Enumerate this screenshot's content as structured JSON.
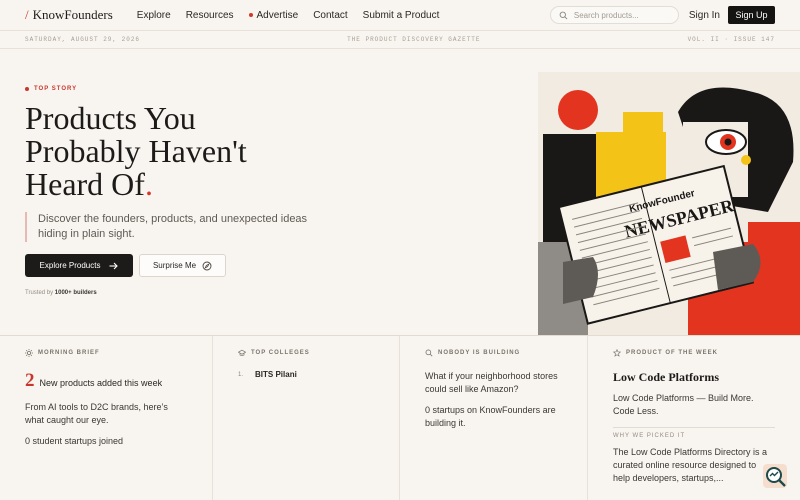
{
  "nav": {
    "brand": "KnowFounders",
    "links": [
      "Explore",
      "Resources",
      "Advertise",
      "Contact",
      "Submit a Product"
    ],
    "search_placeholder": "Search products...",
    "signin": "Sign In",
    "signup": "Sign Up"
  },
  "gazette": {
    "date": "SATURDAY, AUGUST 29, 2026",
    "title": "THE PRODUCT DISCOVERY GAZETTE",
    "issue": "VOL. II · ISSUE 147"
  },
  "hero": {
    "label": "TOP STORY",
    "headline_l1": "Products You",
    "headline_l2": "Probably Haven't",
    "headline_l3": "Heard Of",
    "headline_dot": ".",
    "subtitle": "Discover the founders, products, and unexpected ideas hiding in plain sight.",
    "primary_btn": "Explore Products",
    "secondary_btn": "Surprise Me",
    "trusted_prefix": "Trusted by",
    "trusted_count": "1000+ builders",
    "art_brand": "KnowFounder",
    "art_paper": "NEWSPAPER"
  },
  "cards": {
    "morning": {
      "label": "MORNING BRIEF",
      "count": "2",
      "count_text": "New products added this week",
      "para1": "From AI tools to D2C brands, here’s what caught our eye.",
      "para2": "0 student startups joined"
    },
    "colleges": {
      "label": "TOP COLLEGES",
      "items": [
        {
          "num": "1.",
          "name": "BITS Pilani"
        }
      ]
    },
    "nobody": {
      "label": "NOBODY IS BUILDING",
      "q": "What if your neighborhood stores could sell like Amazon?",
      "a": "0 startups on KnowFounders are building it."
    },
    "potw": {
      "label": "PRODUCT OF THE WEEK",
      "title": "Low Code Platforms",
      "desc": "Low Code Platforms — Build More. Code Less.",
      "why_label": "WHY WE PICKED IT",
      "why_text": "The Low Code Platforms Directory is a curated online resource designed to help developers, startups,..."
    }
  },
  "colors": {
    "accent": "#c8372d",
    "dark": "#1d1b19",
    "background": "#f8f5f0"
  }
}
